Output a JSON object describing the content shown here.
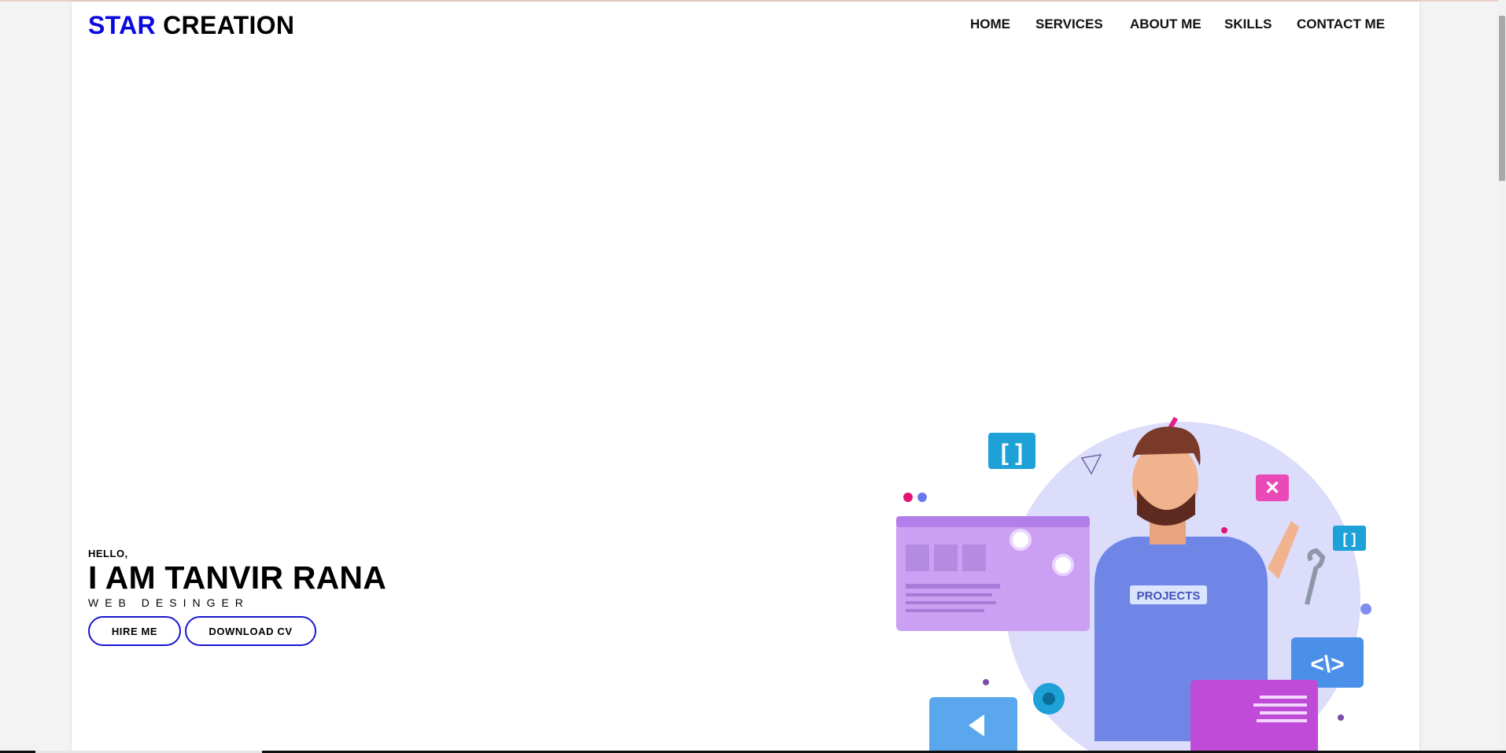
{
  "header": {
    "logo_accent": "STAR",
    "logo_rest": " CREATION",
    "nav": [
      "HOME",
      "SERVICES",
      "ABOUT ME",
      "SKILLS",
      "CONTACT ME"
    ]
  },
  "hero": {
    "greeting": "HELLO,",
    "headline": "I AM TANVIR RANA",
    "role": "WEB DESINGER",
    "hire_button": "HIRE ME",
    "download_button": "DOWNLOAD CV",
    "illustration_shirt_text": "PROJECTS"
  },
  "colors": {
    "accent": "#0a08e0",
    "button_border": "#1a17d0",
    "illustration_purple": "#c99cf2",
    "illustration_blue": "#4a8fe8",
    "illustration_circle": "#dcdcfb"
  }
}
